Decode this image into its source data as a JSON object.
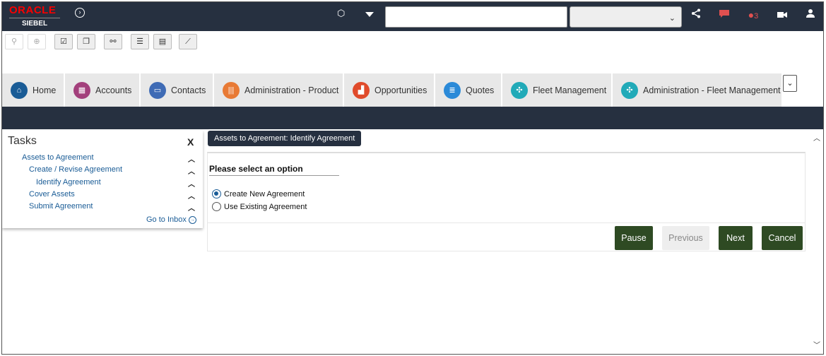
{
  "header": {
    "logo_oracle": "ORACLE",
    "logo_siebel": "SIEBEL",
    "search_value": "",
    "search_select_value": "",
    "notification_count": "3"
  },
  "tabs": [
    {
      "label": "Home",
      "icon": "home-icon",
      "color": "#1a5c96"
    },
    {
      "label": "Accounts",
      "icon": "building-icon",
      "color": "#a3407c"
    },
    {
      "label": "Contacts",
      "icon": "contact-card-icon",
      "color": "#3f6bb5"
    },
    {
      "label": "Administration - Product",
      "icon": "barcode-icon",
      "color": "#e87a35"
    },
    {
      "label": "Opportunities",
      "icon": "chart-icon",
      "color": "#e04b2b"
    },
    {
      "label": "Quotes",
      "icon": "document-icon",
      "color": "#2b8ad8"
    },
    {
      "label": "Fleet Management",
      "icon": "fleet-icon",
      "color": "#21aab8"
    },
    {
      "label": "Administration - Fleet Management",
      "icon": "fleet-admin-icon",
      "color": "#21aab8"
    }
  ],
  "tasks": {
    "title": "Tasks",
    "close": "X",
    "items": [
      {
        "label": "Assets to Agreement"
      },
      {
        "label": "Create / Revise Agreement"
      },
      {
        "label": "Identify Agreement"
      },
      {
        "label": "Cover Assets"
      },
      {
        "label": "Submit Agreement"
      }
    ],
    "goto_inbox": "Go to Inbox"
  },
  "main": {
    "breadcrumb": "Assets to Agreement:  Identify Agreement",
    "prompt": "Please select an option",
    "options": [
      {
        "label": "Create New Agreement",
        "selected": true
      },
      {
        "label": "Use Existing Agreement",
        "selected": false
      }
    ],
    "buttons": {
      "pause": "Pause",
      "previous": "Previous",
      "next": "Next",
      "cancel": "Cancel"
    }
  },
  "colors": {
    "header_bg": "#263040",
    "button_green": "#2e4a23",
    "link_blue": "#1a5c96"
  }
}
